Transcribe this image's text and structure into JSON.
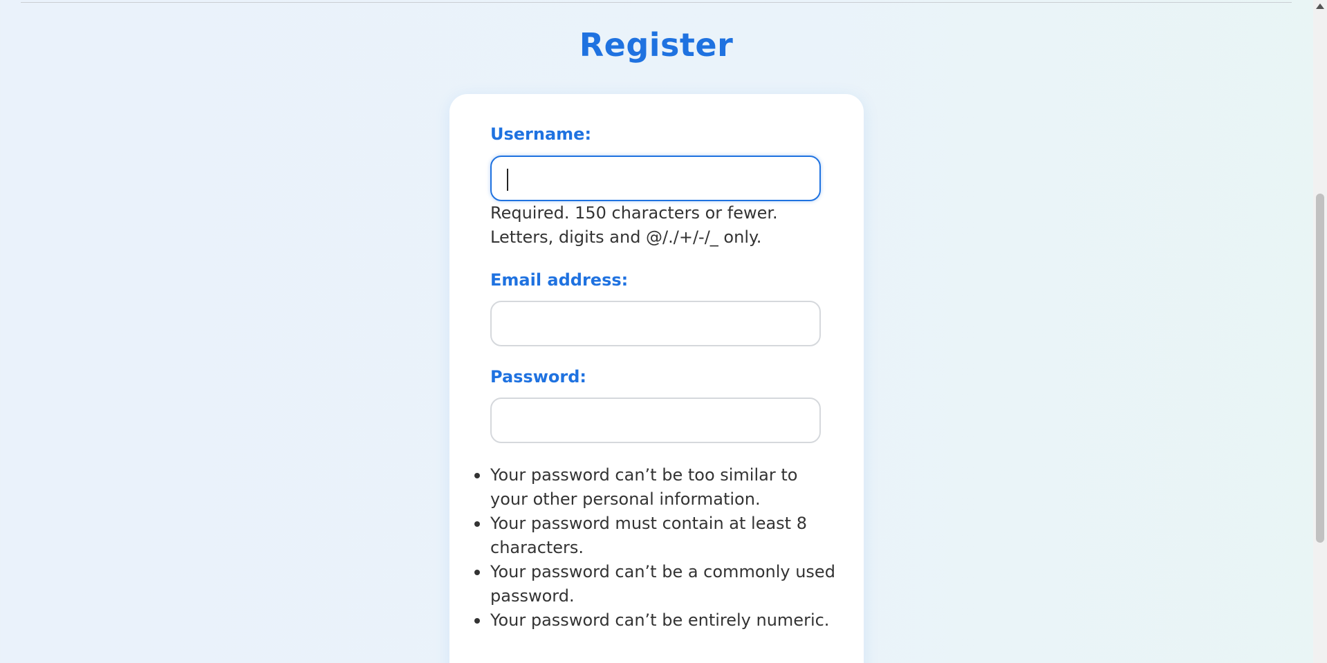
{
  "page": {
    "title": "Register"
  },
  "form": {
    "username": {
      "label": "Username:",
      "value": "",
      "help": [
        "Required. 150 characters or fewer.",
        "Letters, digits and @/./+/-/_ only."
      ]
    },
    "email": {
      "label": "Email address:",
      "value": ""
    },
    "password": {
      "label": "Password:",
      "value": "",
      "rules": [
        "Your password can’t be too similar to your other personal information.",
        "Your password must contain at least 8 characters.",
        "Your password can’t be a commonly used password.",
        "Your password can’t be entirely numeric."
      ]
    }
  },
  "theme": {
    "accent": "#1f72e0",
    "text": "#333333",
    "card": "#ffffff"
  },
  "icons": {
    "scroll_up": "scroll-up-arrow-icon",
    "bullet": "bullet-icon"
  }
}
